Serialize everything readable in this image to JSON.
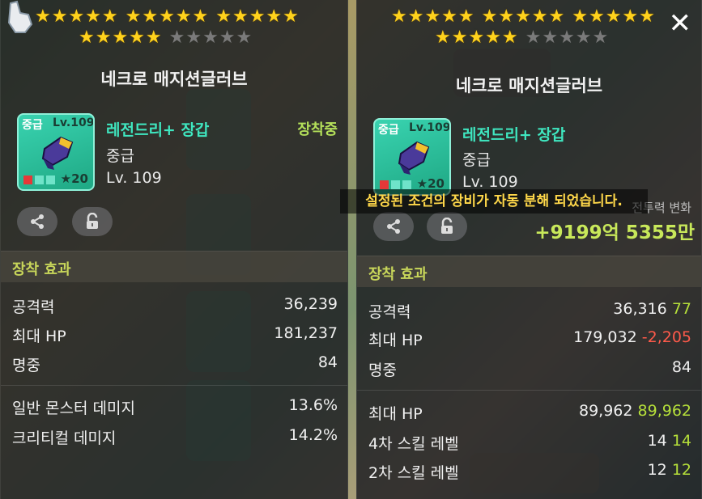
{
  "left_panel": {
    "stars_row1": [
      1,
      1,
      1,
      1,
      1,
      1,
      1,
      1,
      1,
      1,
      1,
      1,
      1,
      1,
      1
    ],
    "stars_row2_on": 5,
    "stars_row2_off": 5,
    "item_name": "네크로 매지션글러브",
    "icon": {
      "grade": "중급",
      "level": "Lv.109",
      "stars": "★20"
    },
    "rarity": "레전드리+ 장갑",
    "subgrade": "중급",
    "required_level": "Lv. 109",
    "equipped": "장착중",
    "share_icon": "share-icon",
    "lock_icon": "unlock-icon",
    "section_title": "장착 효과",
    "stats": [
      {
        "label": "공격력",
        "value": "36,239"
      },
      {
        "label": "최대 HP",
        "value": "181,237"
      },
      {
        "label": "명중",
        "value": "84"
      }
    ],
    "extra_stats": [
      {
        "label": "일반 몬스터 데미지",
        "value": "13.6%"
      },
      {
        "label": "크리티컬 데미지",
        "value": "14.2%"
      }
    ]
  },
  "right_panel": {
    "item_name": "네크로 매지션글러브",
    "icon": {
      "grade": "중급",
      "level": "Lv.109",
      "stars": "★20"
    },
    "rarity": "레전드리+ 장갑",
    "subgrade": "중급",
    "required_level": "Lv. 109",
    "combat_label": "전투력 변화",
    "combat_value": "+9199억 5355만",
    "section_title": "장착 효과",
    "stats": [
      {
        "label": "공격력",
        "value": "36,316",
        "diff": "77",
        "diff_type": "up"
      },
      {
        "label": "최대 HP",
        "value": "179,032",
        "diff": "-2,205",
        "diff_type": "down"
      },
      {
        "label": "명중",
        "value": "84",
        "diff": "",
        "diff_type": ""
      }
    ],
    "extra_stats": [
      {
        "label": "최대 HP",
        "value": "89,962",
        "diff": "89,962"
      },
      {
        "label": "4차 스킬 레벨",
        "value": "14",
        "diff": "14"
      },
      {
        "label": "2차 스킬 레벨",
        "value": "12",
        "diff": "12"
      }
    ]
  },
  "toast": "설정된 조건의 장비가 자동 분해 되었습니다.",
  "close_icon": "close-icon",
  "colors": {
    "star_on": "#ffd21c",
    "rarity": "#3fe7c0",
    "equipped": "#b4e05a",
    "section": "#c8d65a",
    "up": "#b6e03a",
    "down": "#ff5a4a"
  }
}
